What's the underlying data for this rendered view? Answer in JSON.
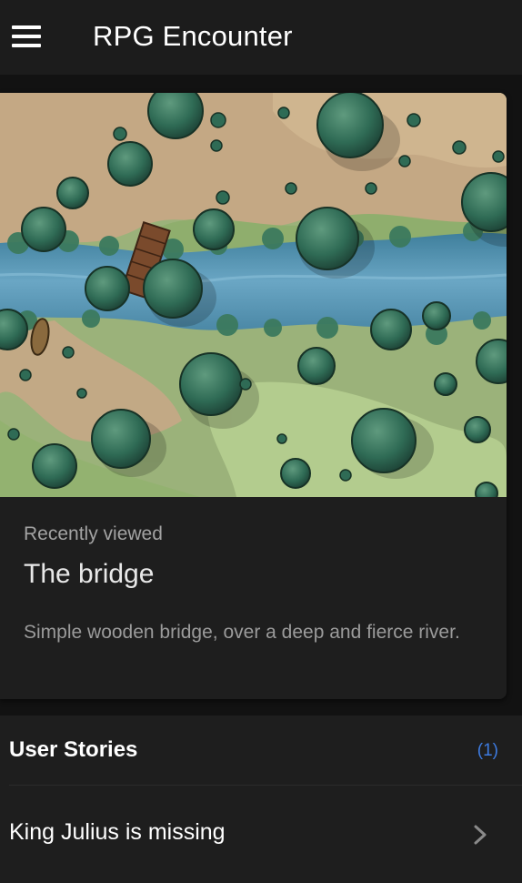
{
  "app_bar": {
    "title": "RPG Encounter",
    "menu_icon": "hamburger-menu-icon"
  },
  "recent_card": {
    "overline": "Recently viewed",
    "title": "The bridge",
    "description": "Simple wooden bridge, over a deep and fierce river.",
    "image": "battle-map-river-bridge"
  },
  "user_stories": {
    "header": "User Stories",
    "count": "(1)",
    "items": [
      {
        "label": "King Julius is missing",
        "icon": "chevron-right-icon"
      }
    ]
  },
  "colors": {
    "background": "#121212",
    "app_bar": "#1c1c1c",
    "card": "#1e1e1e",
    "accent": "#3d7be0"
  }
}
